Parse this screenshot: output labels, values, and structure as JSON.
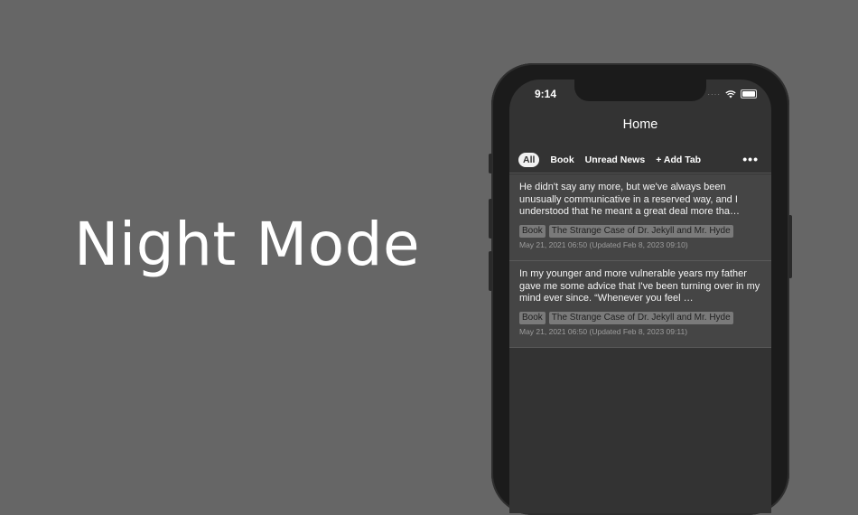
{
  "headline": "Night Mode",
  "status": {
    "time": "9:14",
    "signal": "····"
  },
  "nav": {
    "title": "Home"
  },
  "tabs": [
    {
      "label": "All",
      "active": true
    },
    {
      "label": "Book",
      "active": false
    },
    {
      "label": "Unread News",
      "active": false
    },
    {
      "label": "+ Add Tab",
      "active": false
    }
  ],
  "more_label": "•••",
  "items": [
    {
      "text": "He didn't say any more, but we've always been unusually communicative in a reserved way, and I understood that he meant a great deal more tha…",
      "tags": [
        "Book",
        "The Strange Case of Dr. Jekyll and Mr. Hyde"
      ],
      "date": "May 21, 2021 06:50 (Updated Feb 8, 2023 09:10)"
    },
    {
      "text": "In my younger and more vulnerable years my father gave me some advice that I've been turning over in my mind ever since.  “Whenever you feel …",
      "tags": [
        "Book",
        "The Strange Case of Dr. Jekyll and Mr. Hyde"
      ],
      "date": "May 21, 2021 06:50 (Updated Feb 8, 2023 09:11)"
    }
  ],
  "colors": {
    "background": "#666666",
    "screen": "#333333",
    "card": "#454545",
    "tag": "#7a7a7a"
  }
}
